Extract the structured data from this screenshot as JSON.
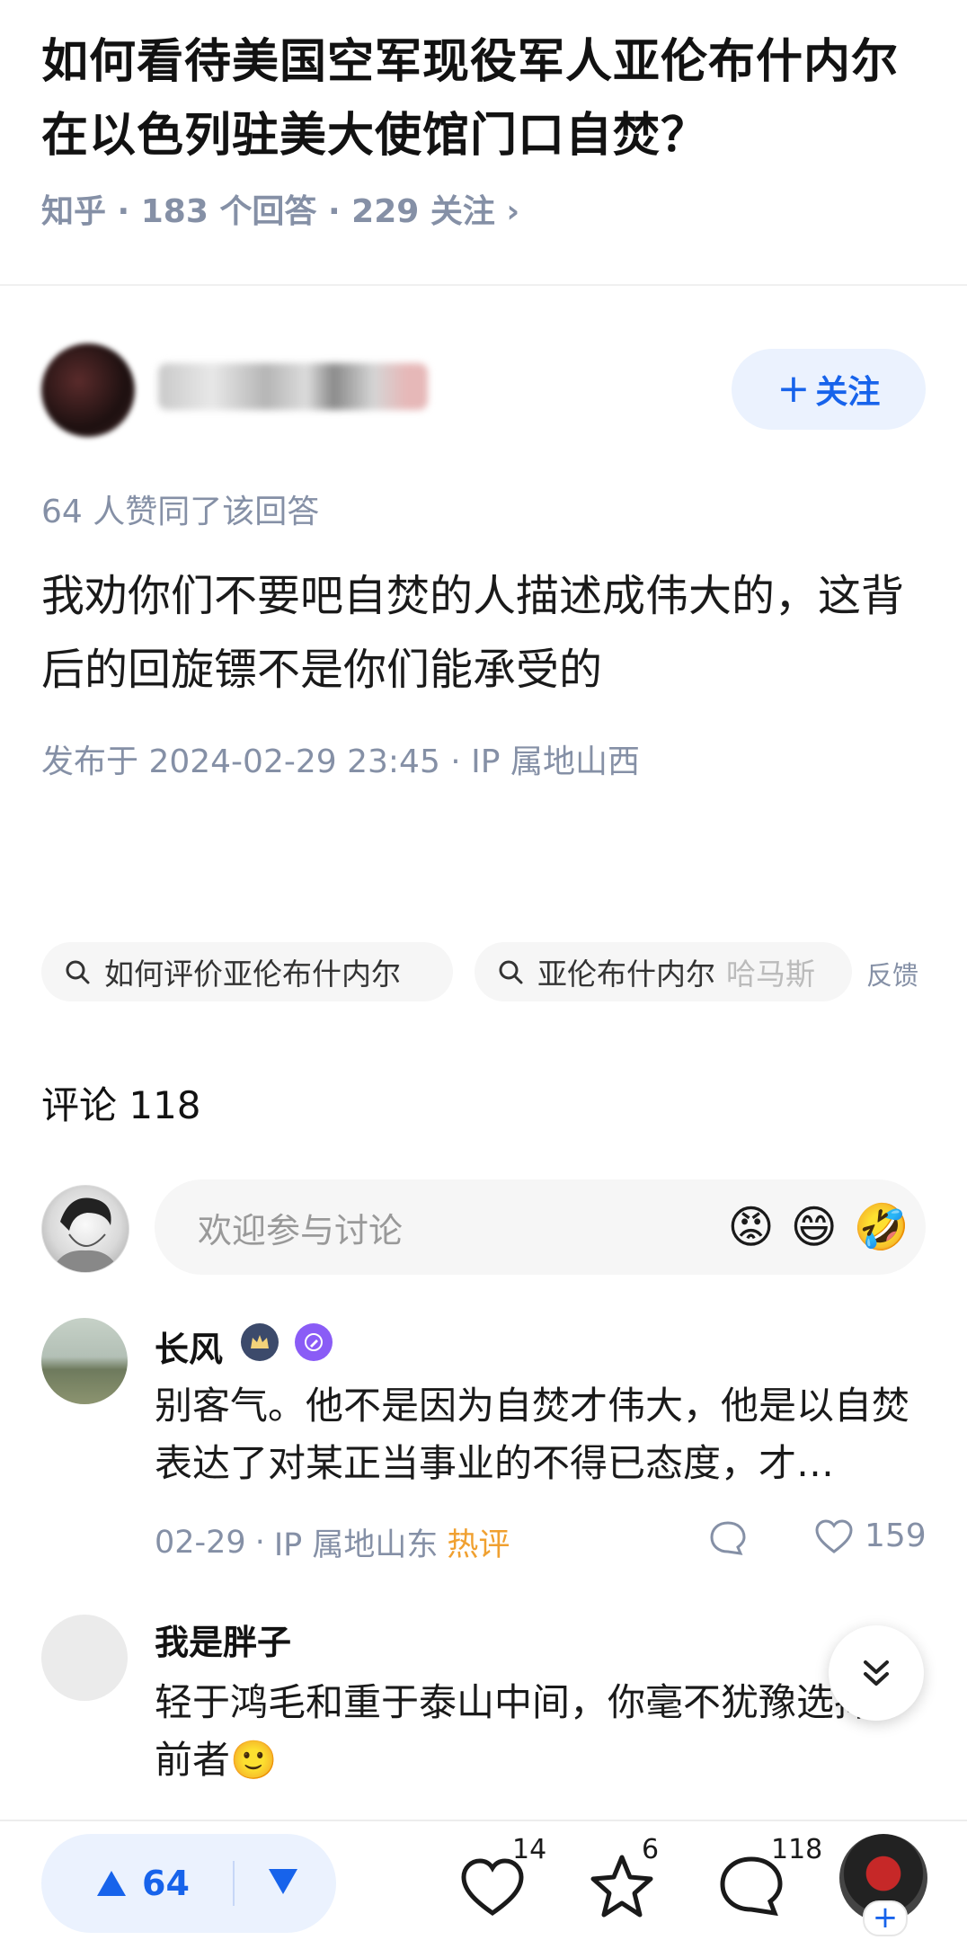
{
  "question": {
    "title": "如何看待美国空军现役军人亚伦布什内尔在以色列驻美大使馆门口自焚？",
    "meta": "知乎 · 183 个回答 · 229 关注 ›"
  },
  "author": {
    "follow_label": "关注",
    "follow_icon": "plus-icon"
  },
  "answer": {
    "agree_text": "64 人赞同了该回答",
    "content": "我劝你们不要吧自焚的人描述成伟大的，这背后的回旋镖不是你们能承受的",
    "published": "发布于 2024-02-29 23:45 · IP 属地山西"
  },
  "related_searches": [
    {
      "label": "如何评价亚伦布什内尔"
    },
    {
      "label": "亚伦布什内尔",
      "fade": "哈马斯"
    }
  ],
  "feedback_label": "反馈",
  "comments": {
    "title": "评论 118",
    "input_placeholder": "欢迎参与讨论",
    "emojis": [
      "😡",
      "😄",
      "🤣"
    ],
    "items": [
      {
        "name": "长风",
        "text": "别客气。他不是因为自焚才伟大，他是以自焚表达了对某正当事业的不得已态度，才…",
        "date": "02-29",
        "location": "IP 属地山东",
        "tag": "热评",
        "likes": "159"
      },
      {
        "name": "我是胖子",
        "text": "轻于鸿毛和重于泰山中间，你毫不犹豫选择了前者🙂"
      }
    ]
  },
  "bottom_bar": {
    "upvotes": "64",
    "like_count": "14",
    "favorite_count": "6",
    "comment_count": "118",
    "accent": "#1763eb"
  }
}
